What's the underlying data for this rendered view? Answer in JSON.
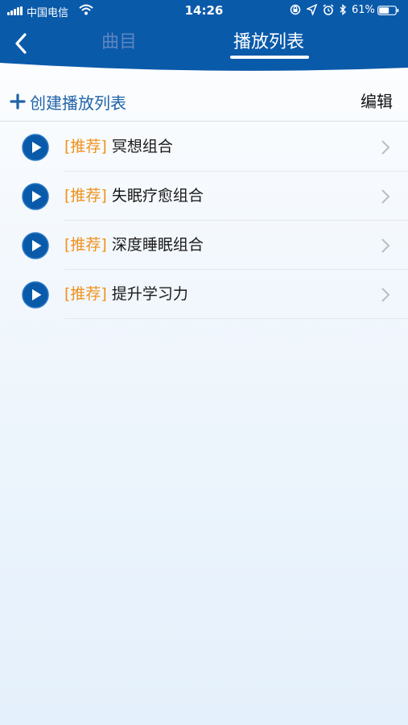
{
  "status_bar": {
    "carrier": "中国电信",
    "time": "14:26",
    "battery_percent": "61%",
    "battery_level": 0.61
  },
  "nav": {
    "tabs": [
      {
        "label": "曲目",
        "active": false
      },
      {
        "label": "播放列表",
        "active": true
      }
    ]
  },
  "toolbar": {
    "create_label": "创建播放列表",
    "edit_label": "编辑"
  },
  "playlists": [
    {
      "tag": "[推荐]",
      "name": "冥想组合"
    },
    {
      "tag": "[推荐]",
      "name": "失眠疗愈组合"
    },
    {
      "tag": "[推荐]",
      "name": "深度睡眠组合"
    },
    {
      "tag": "[推荐]",
      "name": "提升学习力"
    }
  ],
  "colors": {
    "header_blue": "#0a5aaa",
    "accent_blue": "#1f63a8",
    "tag_orange": "#f0921c",
    "inactive_tab": "#5d86c0"
  }
}
